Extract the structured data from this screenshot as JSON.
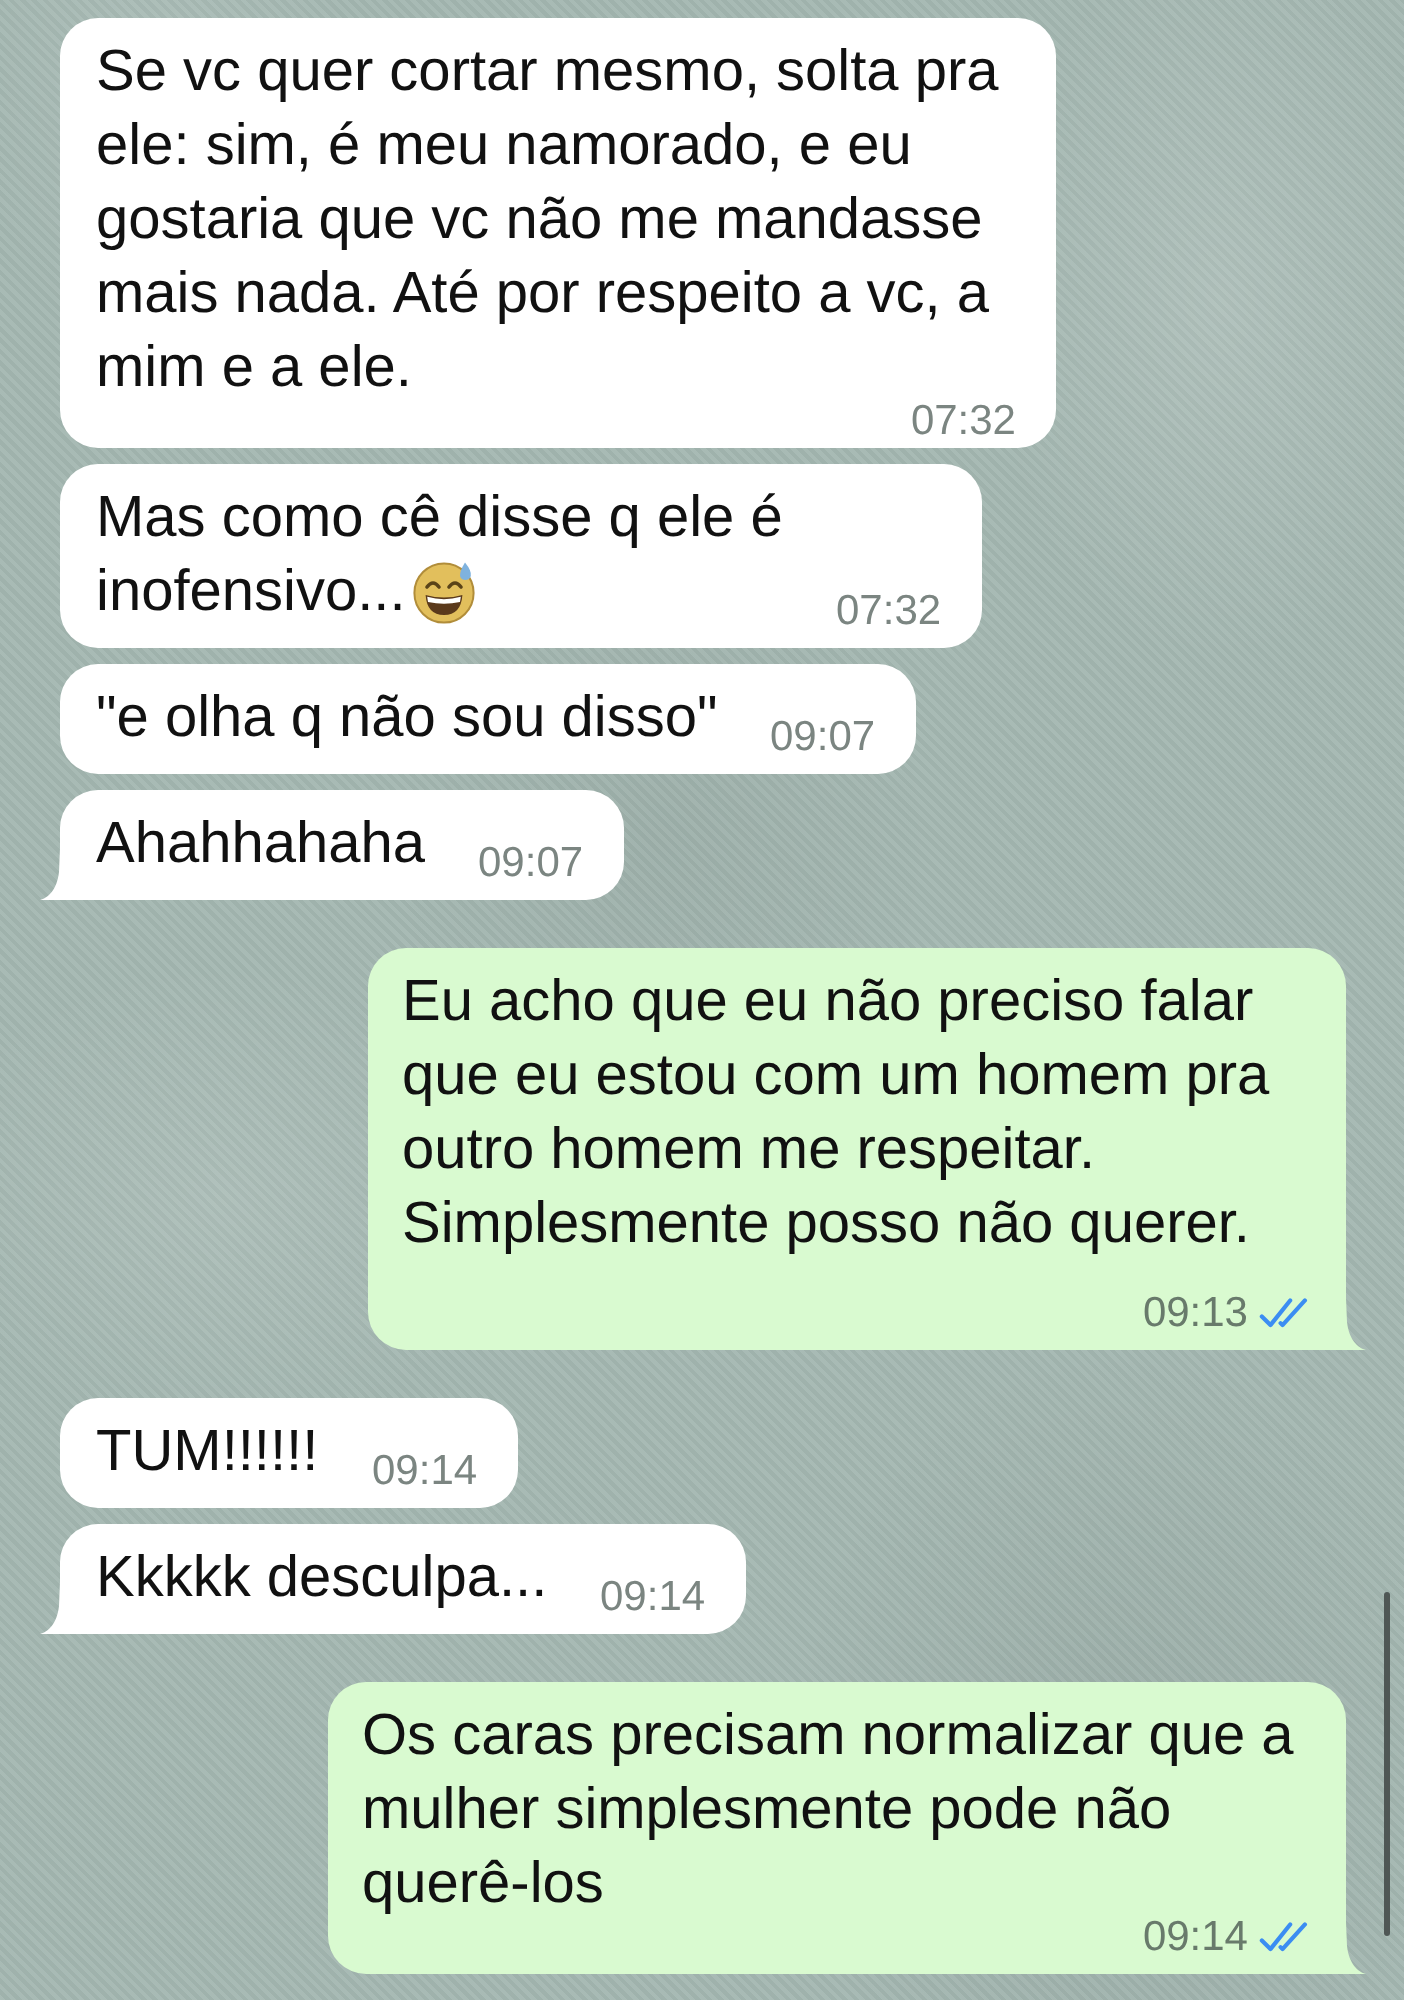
{
  "messages": [
    {
      "kind": "incoming",
      "text": "Se vc quer cortar mesmo, solta pra ele: sim, é meu namorado, e eu gostaria que vc não me mandasse mais nada. Até por respeito a vc, a mim e a ele.",
      "time": "07:32",
      "tail": false
    },
    {
      "kind": "incoming",
      "text": "Mas como cê disse q ele é inofensivo...",
      "emoji": true,
      "time": "07:32",
      "tail": false
    },
    {
      "kind": "incoming",
      "text": "\"e olha q não sou disso\"",
      "time": "09:07",
      "tail": false
    },
    {
      "kind": "incoming",
      "text": "Ahahhahaha",
      "time": "09:07",
      "tail": true
    },
    {
      "kind": "outgoing",
      "text": "Eu acho que eu não preciso falar que eu estou com um homem pra outro homem me respeitar. Simplesmente posso não querer.",
      "time": "09:13",
      "read": true,
      "tail": true
    },
    {
      "kind": "incoming",
      "text": "TUM!!!!!!",
      "time": "09:14",
      "tail": false
    },
    {
      "kind": "incoming",
      "text": "Kkkkk desculpa...",
      "time": "09:14",
      "tail": true
    },
    {
      "kind": "outgoing",
      "text": "Os caras precisam normalizar que a mulher simplesmente pode não querê-los",
      "time": "09:14",
      "read": true,
      "tail": true
    }
  ]
}
